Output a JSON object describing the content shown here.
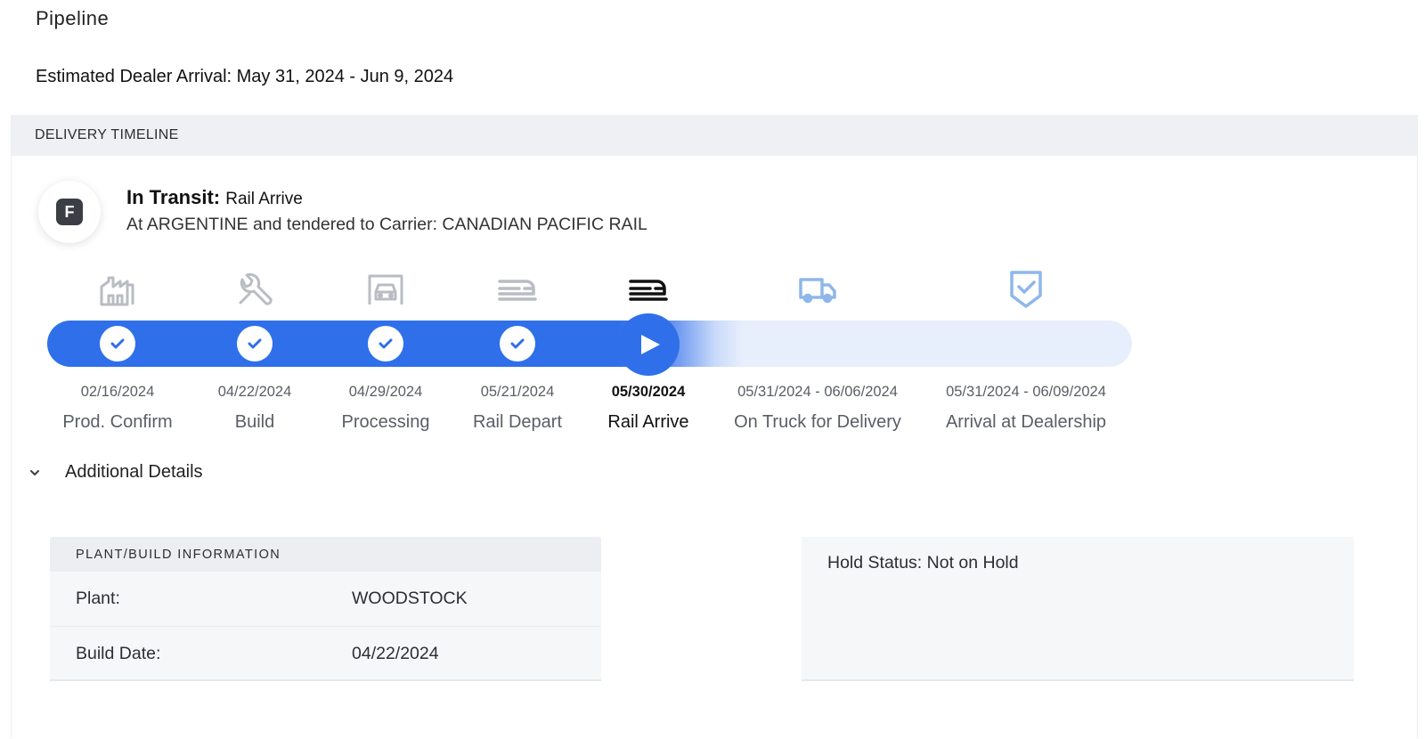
{
  "page": {
    "title": "Pipeline",
    "eta": "Estimated Dealer Arrival: May 31, 2024 - Jun 9, 2024"
  },
  "timeline": {
    "header": "DELIVERY TIMELINE",
    "status_letter": "F",
    "status_label": "In Transit:",
    "status_stage": "Rail Arrive",
    "status_desc": "At ARGENTINE and tendered to Carrier: CANADIAN PACIFIC RAIL",
    "progress_color": "#2f6fea",
    "steps": [
      {
        "date": "02/16/2024",
        "name": "Prod. Confirm",
        "icon": "factory-icon",
        "state": "complete"
      },
      {
        "date": "04/22/2024",
        "name": "Build",
        "icon": "wrench-icon",
        "state": "complete"
      },
      {
        "date": "04/29/2024",
        "name": "Processing",
        "icon": "car-bay-icon",
        "state": "complete"
      },
      {
        "date": "05/21/2024",
        "name": "Rail Depart",
        "icon": "rail-car-icon",
        "state": "complete"
      },
      {
        "date": "05/30/2024",
        "name": "Rail Arrive",
        "icon": "rail-car-icon",
        "state": "current"
      },
      {
        "date": "05/31/2024 - 06/06/2024",
        "name": "On Truck for Delivery",
        "icon": "truck-icon",
        "state": "upcoming"
      },
      {
        "date": "05/31/2024 - 06/09/2024",
        "name": "Arrival at Dealership",
        "icon": "shield-check-icon",
        "state": "upcoming"
      }
    ]
  },
  "details": {
    "toggle_label": "Additional Details",
    "plant_header": "PLANT/BUILD INFORMATION",
    "rows": [
      {
        "key": "Plant:",
        "value": "WOODSTOCK"
      },
      {
        "key": "Build Date:",
        "value": "04/22/2024"
      }
    ],
    "hold_status": "Hold Status: Not on Hold"
  }
}
